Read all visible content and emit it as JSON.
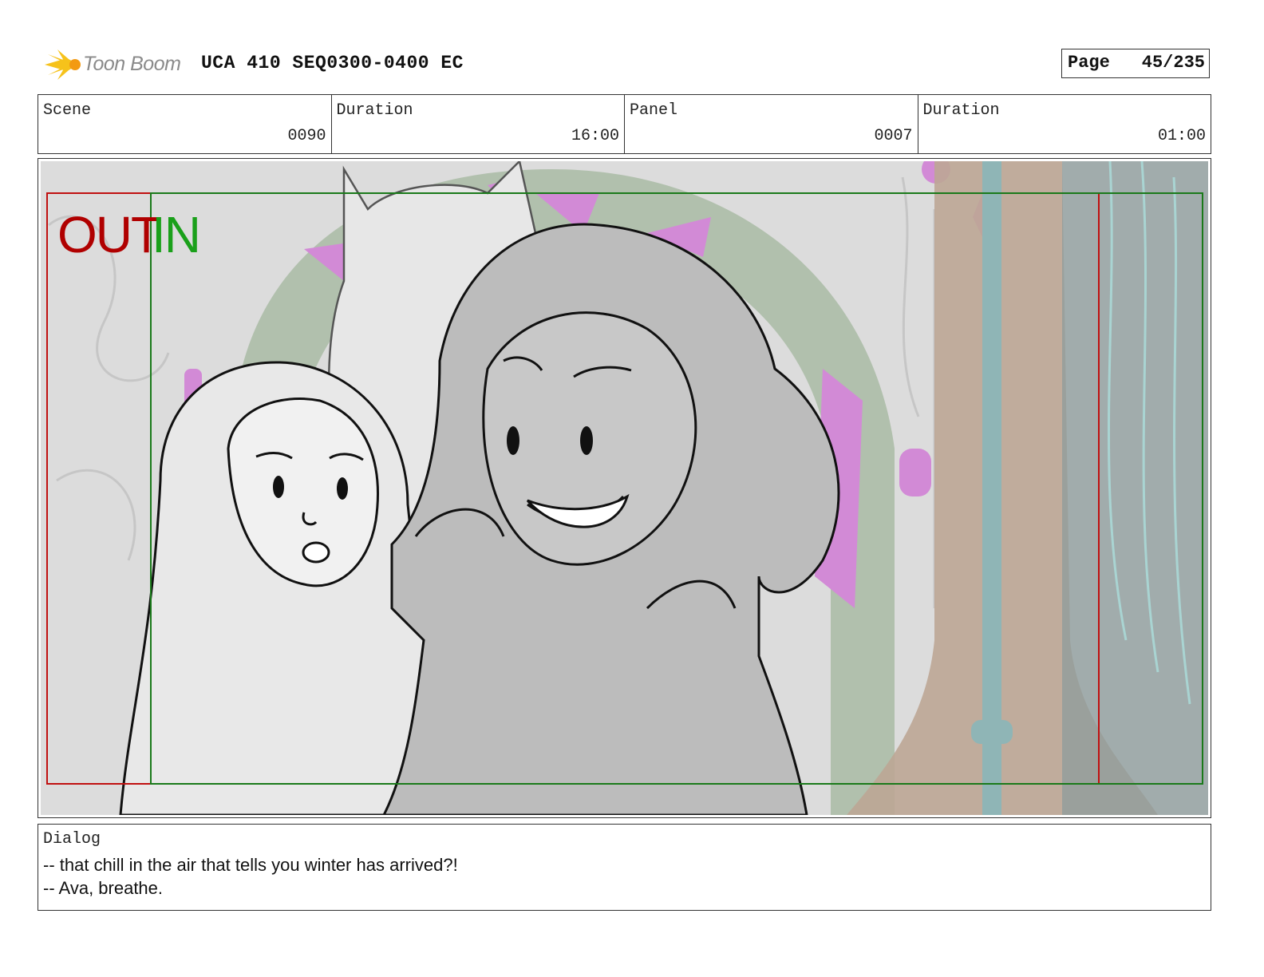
{
  "header": {
    "logo_text": "Toon Boom",
    "project_title": "UCA 410 SEQ0300-0400 EC",
    "page_label": "Page",
    "page_value": "45/235"
  },
  "info": {
    "scene_label": "Scene",
    "scene_value": "0090",
    "scene_duration_label": "Duration",
    "scene_duration_value": "16:00",
    "panel_label": "Panel",
    "panel_value": "0007",
    "panel_duration_label": "Duration",
    "panel_duration_value": "01:00"
  },
  "panel": {
    "out_label": "OUT",
    "in_label": "IN",
    "out_color": "#b00000",
    "in_color": "#1aa01a"
  },
  "dialog": {
    "label": "Dialog",
    "lines": [
      "-- that chill in the air that tells you winter has arrived?!",
      "-- Ava, breathe."
    ]
  }
}
